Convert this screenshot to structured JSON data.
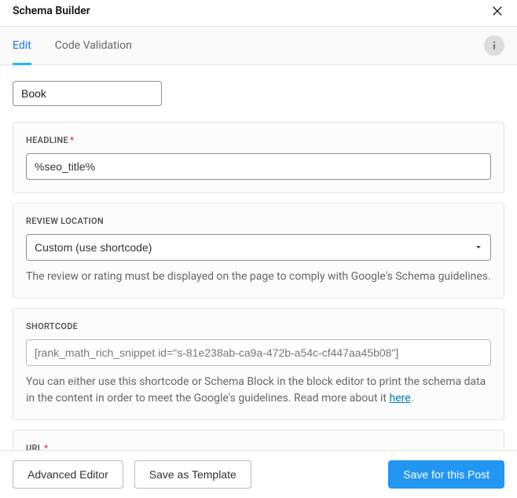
{
  "header": {
    "title": "Schema Builder"
  },
  "tabs": {
    "edit": "Edit",
    "code_validation": "Code Validation"
  },
  "schema_type": "Book",
  "fields": {
    "headline": {
      "label": "Headline",
      "value": "%seo_title%"
    },
    "review_location": {
      "label": "Review Location",
      "value": "Custom (use shortcode)",
      "help": "The review or rating must be displayed on the page to comply with Google's Schema guidelines."
    },
    "shortcode": {
      "label": "Shortcode",
      "value": "[rank_math_rich_snippet id=\"s-81e238ab-ca9a-472b-a54c-cf447aa45b08\"]",
      "help_prefix": "You can either use this shortcode or Schema Block in the block editor to print the schema data in the content in order to meet the Google's guidelines. Read more about it ",
      "help_link": "here",
      "help_suffix": "."
    },
    "url": {
      "label": "URL"
    }
  },
  "footer": {
    "advanced": "Advanced Editor",
    "save_template": "Save as Template",
    "save_post": "Save for this Post"
  }
}
